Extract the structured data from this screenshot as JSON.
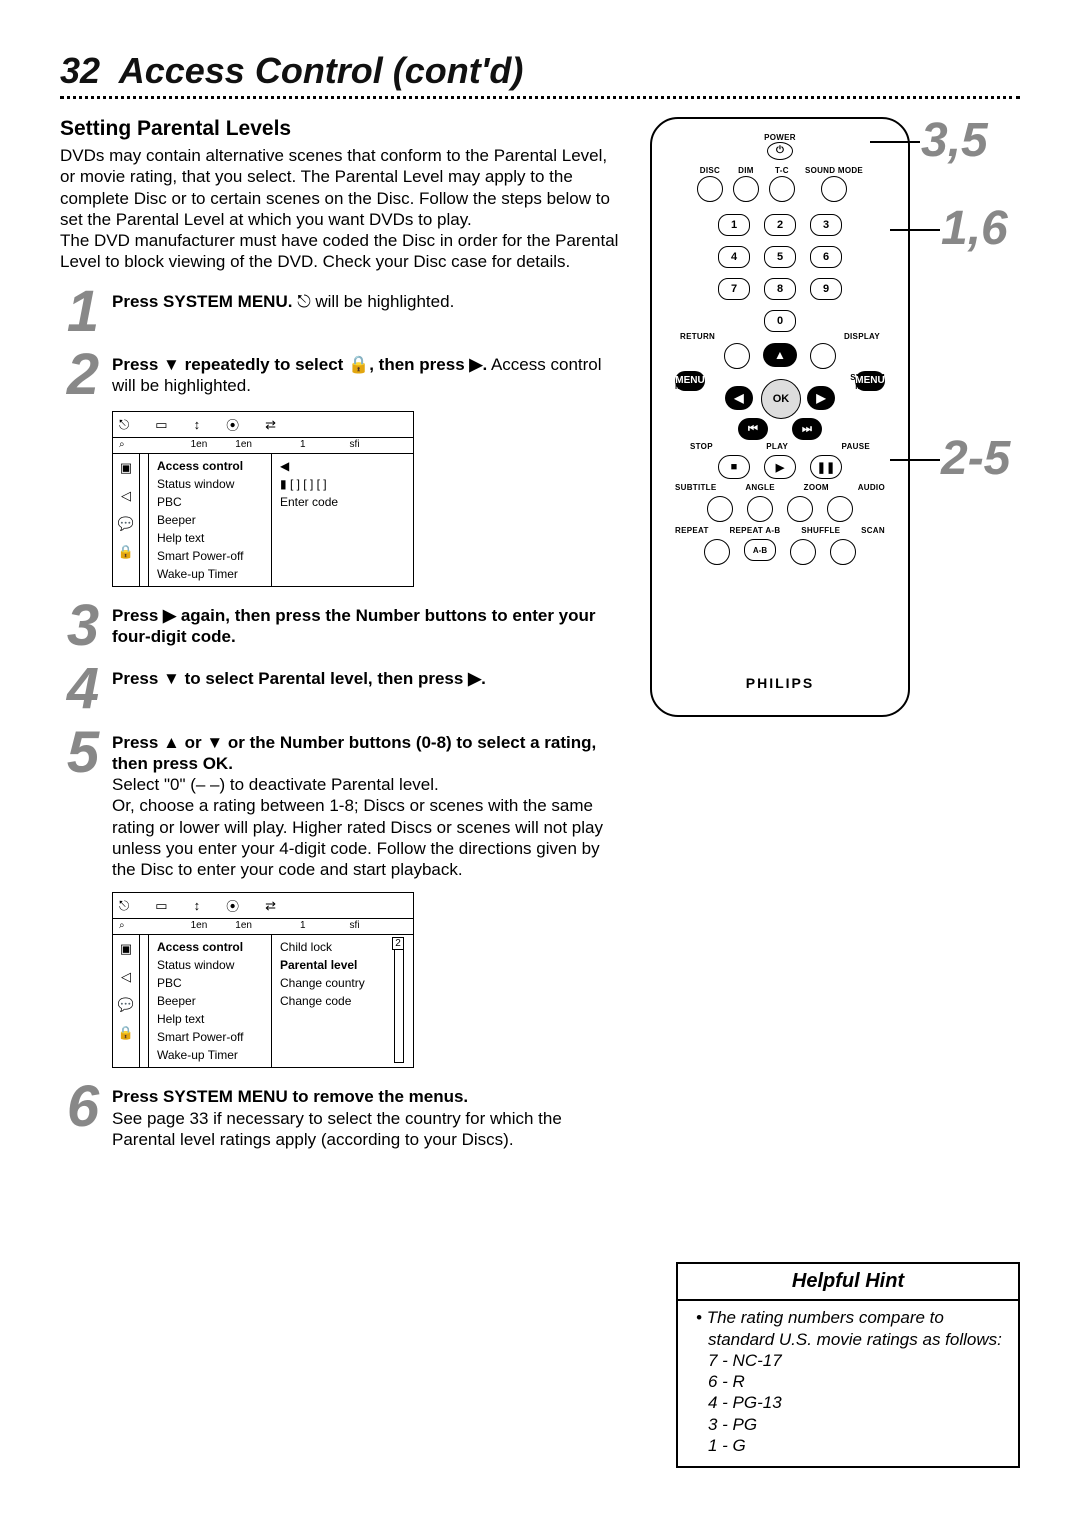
{
  "page_number": "32",
  "page_title": "Access Control (cont'd)",
  "section_heading": "Setting Parental Levels",
  "intro": "DVDs may contain alternative scenes that conform to the Parental Level, or movie rating, that you select. The Parental Level may apply to the complete Disc or to certain scenes on the Disc. Follow the steps below to set the Parental Level at which you want DVDs to play.\nThe DVD manufacturer must have coded the Disc in order for the Parental Level to block viewing of the DVD. Check your Disc case for details.",
  "steps": [
    {
      "n": "1",
      "bold": "Press SYSTEM MENU.",
      "tail_html": " <span class='symbol'>⎋</span> will be highlighted."
    },
    {
      "n": "2",
      "bold_html": "Press <span class='symbol'>▼</span> repeatedly to select <span class='symbol'>🔒</span>, then press <span class='symbol'>▶</span>.",
      "tail": " Access control will be highlighted."
    },
    {
      "n": "3",
      "bold_html": "Press <span class='symbol'>▶</span> again, then press the Number buttons to enter your four-digit code.",
      "tail": ""
    },
    {
      "n": "4",
      "bold_html": "Press <span class='symbol'>▼</span> to select Parental level, then press <span class='symbol'>▶</span>.",
      "tail": ""
    },
    {
      "n": "5",
      "bold_html": "Press <span class='symbol'>▲</span> or <span class='symbol'>▼</span> or the Number buttons (0-8) to select a rating, then press OK.",
      "tail": "\nSelect \"0\" (– –) to deactivate Parental level.\nOr, choose a rating between 1-8; Discs or scenes with the same rating or lower will play. Higher rated Discs or scenes will not play unless you enter your 4-digit code. Follow the directions given by the Disc to enter your code and start playback."
    },
    {
      "n": "6",
      "bold": "Press SYSTEM MENU to remove the menus.",
      "tail": "\nSee page 33 if necessary to select the country for which the Parental level ratings apply (according to your Discs)."
    }
  ],
  "osd": {
    "header_icons": [
      "⎋",
      "▭",
      "↕",
      "⦿",
      "⇄"
    ],
    "header_sub": [
      "",
      "1en",
      "1en",
      "1",
      "sfi"
    ],
    "sidebar_icons": [
      "▣",
      "◁",
      "💬",
      "🔒"
    ],
    "menu_items": [
      "Access control",
      "Status window",
      "PBC",
      "Beeper",
      "Help text",
      "Smart Power-off",
      "Wake-up Timer"
    ],
    "right_pane_1": [
      "◀",
      "▮ [ ] [ ] [ ]",
      "Enter code"
    ],
    "right_pane_2": [
      "Child lock",
      "Parental level",
      "Change country",
      "Change code"
    ],
    "right_pane_2_highlight": "Parental level",
    "right_pane_2_indicator": "2"
  },
  "remote": {
    "top_label": "POWER",
    "top_row_labels": [
      "DISC",
      "DIM",
      "T-C",
      "SOUND MODE"
    ],
    "numpad": [
      [
        "1",
        "2",
        "3"
      ],
      [
        "4",
        "5",
        "6"
      ],
      [
        "7",
        "8",
        "9"
      ],
      [
        "",
        "0",
        ""
      ]
    ],
    "row_under_7_left": "RETURN",
    "row_under_9_right": "DISPLAY",
    "menu_left": "DISC\nMENU",
    "menu_right": "SYSTEM\nMENU",
    "ok": "OK",
    "transport_labels": [
      "STOP",
      "PLAY",
      "PAUSE"
    ],
    "mode_labels": [
      "SUBTITLE",
      "ANGLE",
      "ZOOM",
      "AUDIO"
    ],
    "bottom_labels": [
      "REPEAT",
      "REPEAT A-B",
      "SHUFFLE",
      "SCAN"
    ],
    "brand": "PHILIPS"
  },
  "callouts": {
    "a": "3,5",
    "b": "1,6",
    "c": "2-5"
  },
  "hint": {
    "title": "Helpful Hint",
    "lead": "The rating numbers compare to standard U.S. movie ratings as follows:",
    "lines": [
      "7 - NC-17",
      "6 - R",
      "4 - PG-13",
      "3 - PG",
      "1 - G"
    ]
  }
}
